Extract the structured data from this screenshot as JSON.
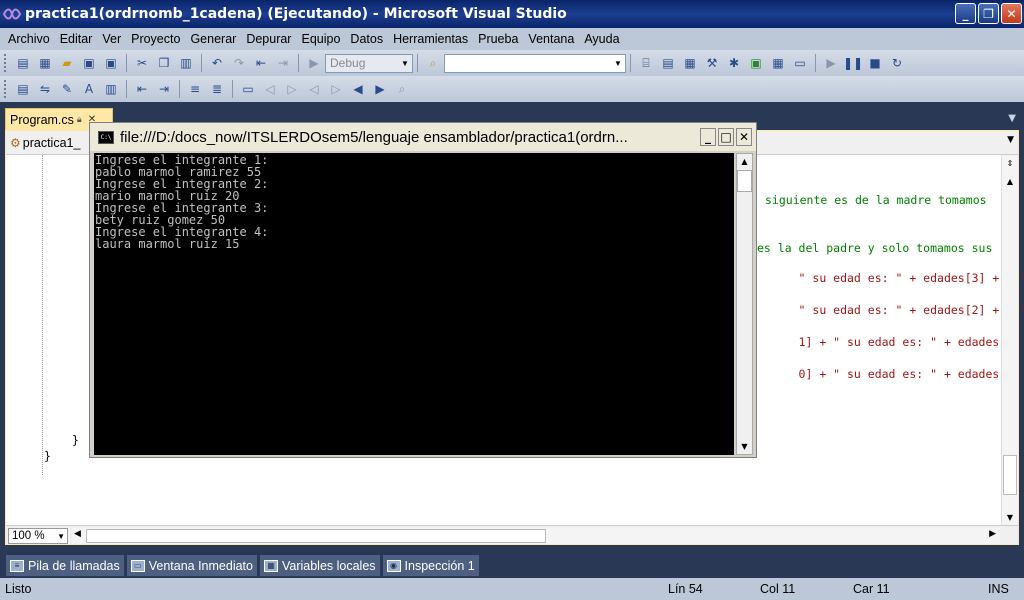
{
  "window": {
    "title": "practica1(ordrnomb_1cadena) (Ejecutando) - Microsoft Visual Studio",
    "minimize": "_",
    "restore": "❐",
    "close": "✕"
  },
  "menu": [
    "Archivo",
    "Editar",
    "Ver",
    "Proyecto",
    "Generar",
    "Depurar",
    "Equipo",
    "Datos",
    "Herramientas",
    "Prueba",
    "Ventana",
    "Ayuda"
  ],
  "toolbar": {
    "config_value": "Debug",
    "search_value": ""
  },
  "editor": {
    "tab_label": "Program.cs",
    "nav_left": "practica1_",
    "zoom": "100 %",
    "code_lines": [
      {
        "text": "siguiente es de la madre tomamos",
        "cls": "comment"
      },
      {
        "text": "es la del padre y solo tomamos sus",
        "cls": "comment"
      },
      {
        "text": "\" su edad es: \" + edades[3] + \".\");",
        "cls": "mixed"
      },
      {
        "text": "\" su edad es: \" + edades[2] + \".\");",
        "cls": "mixed"
      },
      {
        "text": "1] + \" su edad es: \" + edades[1] +",
        "cls": "mixed"
      },
      {
        "text": "0] + \" su edad es: \" + edades[0] +",
        "cls": "mixed"
      }
    ],
    "brace_inner": "}",
    "brace_outer": "}"
  },
  "console": {
    "title": "file:///D:/docs_now/ITSLERDOsem5/lenguaje ensamblador/practica1(ordrn...",
    "icon_text": "C:\\",
    "lines": [
      "Ingrese el integrante 1:",
      "pablo marmol ramirez 55",
      "Ingrese el integrante 2:",
      "mario marmol ruiz 20",
      "Ingrese el integrante 3:",
      "bety ruiz gomez 50",
      "Ingrese el integrante 4:",
      "laura marmol ruiz 15"
    ]
  },
  "tool_windows": [
    "Pila de llamadas",
    "Ventana Inmediato",
    "Variables locales",
    "Inspección 1"
  ],
  "status": {
    "text": "Listo",
    "line": "Lín 54",
    "col": "Col 11",
    "car": "Car 11",
    "mode": "INS"
  }
}
